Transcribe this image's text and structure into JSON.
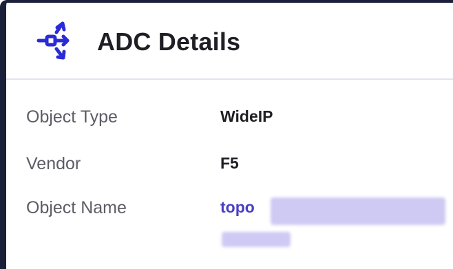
{
  "header": {
    "title": "ADC Details",
    "icon": "adc-network-icon",
    "accent_color": "#2a2ad8"
  },
  "details": {
    "object_type": {
      "label": "Object Type",
      "value": "WideIP"
    },
    "vendor": {
      "label": "Vendor",
      "value": "F5"
    },
    "object_name": {
      "label": "Object Name",
      "value": "topo"
    }
  },
  "colors": {
    "link": "#4a3fc2",
    "label": "#5c5c66",
    "value": "#1e1e24",
    "redaction": "#cfcaf3"
  }
}
